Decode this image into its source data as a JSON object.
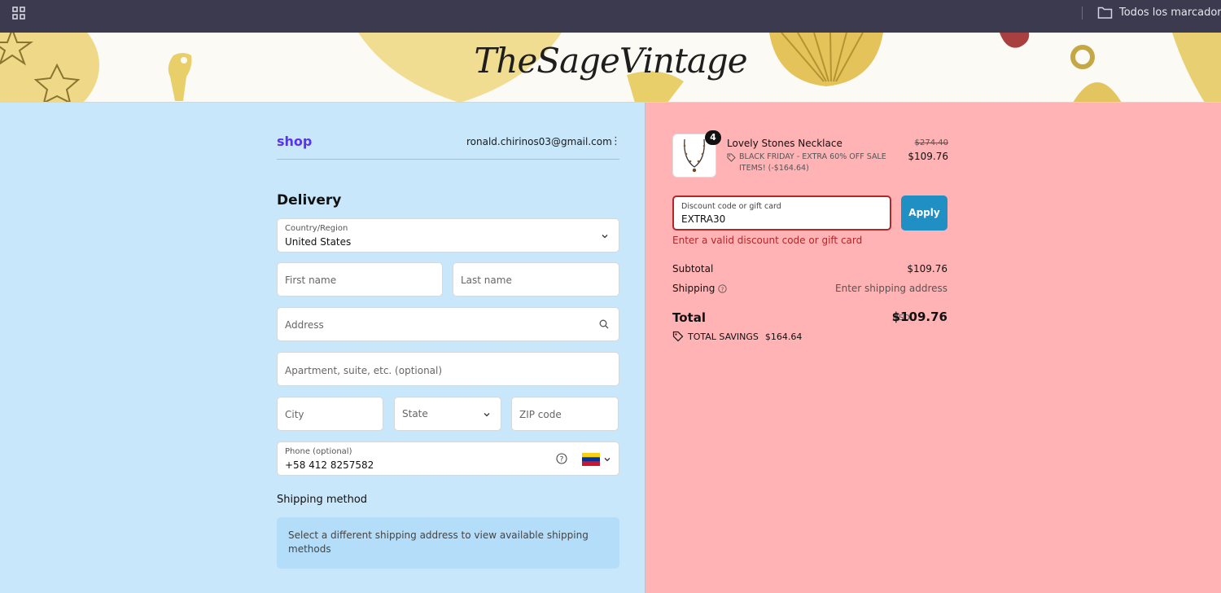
{
  "browser": {
    "bookmarks_label": "Todos los marcadores"
  },
  "banner": {
    "logo_text": "TheSageVintage"
  },
  "checkout": {
    "shop_logo": "shop",
    "email": "ronald.chirinos03@gmail.com",
    "delivery_heading": "Delivery",
    "country": {
      "label": "Country/Region",
      "value": "United States"
    },
    "first_name": {
      "placeholder": "First name"
    },
    "last_name": {
      "placeholder": "Last name"
    },
    "address": {
      "placeholder": "Address"
    },
    "apartment": {
      "placeholder": "Apartment, suite, etc. (optional)"
    },
    "city": {
      "placeholder": "City"
    },
    "state": {
      "placeholder": "State"
    },
    "zip": {
      "placeholder": "ZIP code"
    },
    "phone": {
      "label": "Phone (optional)",
      "value": "+58 412 8257582"
    },
    "shipping_method_heading": "Shipping method",
    "shipping_method_notice": "Select a different shipping address to view available shipping methods"
  },
  "summary": {
    "product": {
      "quantity": "4",
      "name": "Lovely Stones Necklace",
      "discount_text": "BLACK FRIDAY - EXTRA 60% OFF SALE ITEMS! (-$164.64)",
      "original_price": "$274.40",
      "price": "$109.76"
    },
    "discount": {
      "label": "Discount code or gift card",
      "value": "EXTRA30",
      "apply_label": "Apply",
      "error": "Enter a valid discount code or gift card"
    },
    "subtotal": {
      "label": "Subtotal",
      "value": "$109.76"
    },
    "shipping": {
      "label": "Shipping",
      "value": "Enter shipping address"
    },
    "total": {
      "label": "Total",
      "currency": "USD",
      "value": "$109.76"
    },
    "savings": {
      "label": "TOTAL SAVINGS",
      "value": "$164.64"
    }
  },
  "colors": {
    "left_bg": "#c9e7fb",
    "right_bg": "#ffb3b5",
    "apply_button": "#1f8fc4",
    "error": "#b3262a",
    "shop_brand": "#5a31f4"
  },
  "icons": [
    "apps-grid-icon",
    "folder-icon",
    "kebab-menu-icon",
    "chevron-down-icon",
    "search-icon",
    "help-circle-icon",
    "venezuela-flag-icon",
    "tag-icon"
  ]
}
